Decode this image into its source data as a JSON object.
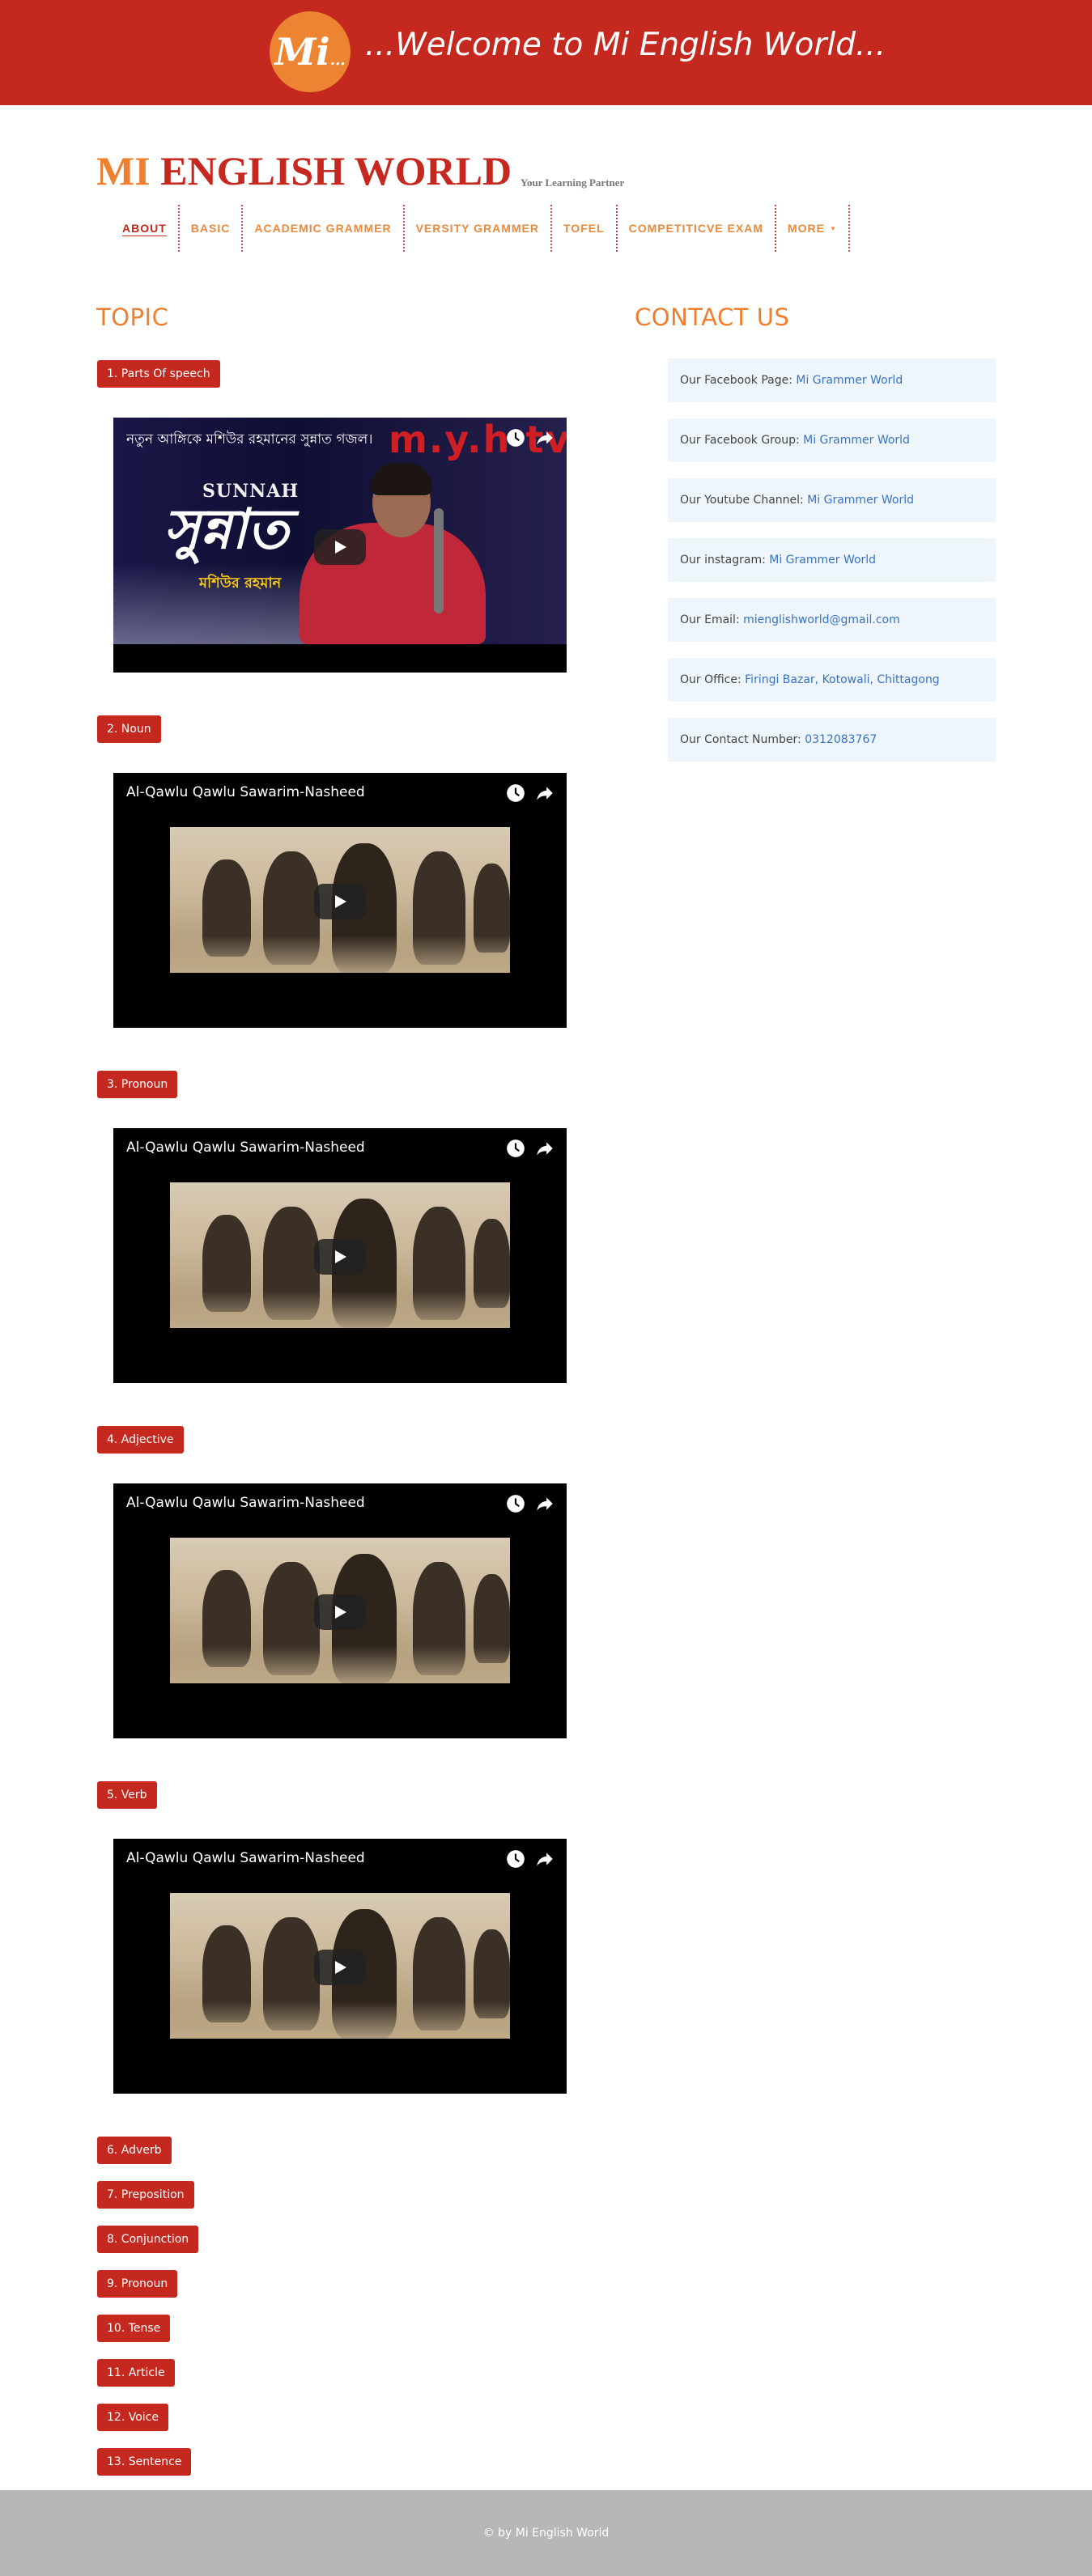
{
  "banner": {
    "logo_text": "Mi",
    "logo_suffix": "...",
    "title": "...Welcome to Mi English World..."
  },
  "brand": {
    "name_part1": "MI",
    "name_part2": " ENGLISH WORLD",
    "tagline": "Your Learning Partner"
  },
  "nav": {
    "items": [
      "ABOUT",
      "BASIC",
      "ACADEMIC GRAMMER",
      "VERSITY GRAMMER",
      "TOFEL",
      "COMPETITICVE EXAM",
      "MORE"
    ],
    "active": "ABOUT",
    "more_caret": "▼"
  },
  "topic": {
    "heading": "TOPIC",
    "items": [
      "1. Parts Of speech",
      "2. Noun",
      "3. Pronoun",
      "4. Adjective",
      "5. Verb",
      "6. Adverb",
      "7. Preposition",
      "8. Conjunction",
      "9. Pronoun",
      "10. Tense",
      "11. Article",
      "12. Voice",
      "13. Sentence"
    ]
  },
  "videos": [
    {
      "title": "নতুন আঙ্গিকে মশিউর রহমানের সুন্নাত গজল।",
      "thumb_heading": "SUNNAH",
      "thumb_script": "সুন্নাত",
      "thumb_subtitle": "মশিউর রহমান",
      "watermark": "m.y.h tv"
    },
    {
      "title": "Al-Qawlu Qawlu Sawarim-Nasheed"
    },
    {
      "title": "Al-Qawlu Qawlu Sawarim-Nasheed"
    },
    {
      "title": "Al-Qawlu Qawlu Sawarim-Nasheed"
    },
    {
      "title": "Al-Qawlu Qawlu Sawarim-Nasheed"
    }
  ],
  "contact": {
    "heading": "CONTACT US",
    "items": [
      {
        "label": "Our Facebook Page: ",
        "value": "Mi Grammer World"
      },
      {
        "label": "Our Facebook Group: ",
        "value": "Mi Grammer World"
      },
      {
        "label": "Our Youtube Channel: ",
        "value": "Mi Grammer World"
      },
      {
        "label": "Our instagram: ",
        "value": "Mi Grammer World"
      },
      {
        "label": "Our Email: ",
        "value": "mienglishworld@gmail.com"
      },
      {
        "label": "Our Office: ",
        "value": "Firingi Bazar, Kotowali, Chittagong"
      },
      {
        "label": "Our Contact Number: ",
        "value": "0312083767"
      }
    ]
  },
  "footer": {
    "text": "© by Mi English World"
  },
  "colors": {
    "primary_red": "#c4281f",
    "accent_orange": "#ee7f2f",
    "link_blue": "#3873c4",
    "contact_bg": "#eef6fc",
    "footer_bg": "#b7b7b7"
  },
  "icons": {
    "video_watch_later": "clock-icon",
    "video_share": "share-icon",
    "video_play": "play-icon"
  }
}
